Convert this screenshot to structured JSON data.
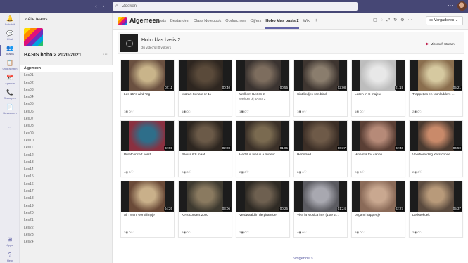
{
  "titlebar": {
    "search_placeholder": "Zoeken",
    "more": "···"
  },
  "rail": {
    "items": [
      {
        "label": "Activiteit",
        "icon": "bell-icon",
        "glyph": "🔔"
      },
      {
        "label": "Chat",
        "icon": "chat-icon",
        "glyph": "💬"
      },
      {
        "label": "Teams",
        "icon": "teams-icon",
        "glyph": "👥"
      },
      {
        "label": "Opdrachten",
        "icon": "assignments-icon",
        "glyph": "📋"
      },
      {
        "label": "Agenda",
        "icon": "calendar-icon",
        "glyph": "📅"
      },
      {
        "label": "Oproepen",
        "icon": "phone-icon",
        "glyph": "📞"
      },
      {
        "label": "Bestanden",
        "icon": "files-icon",
        "glyph": "📄"
      },
      {
        "label": "···",
        "icon": "more-icon",
        "glyph": ""
      },
      {
        "label": "Apps",
        "icon": "apps-icon",
        "glyph": "⊞"
      },
      {
        "label": "Help",
        "icon": "help-icon",
        "glyph": "?"
      }
    ]
  },
  "sidebar": {
    "back_label": "Alle teams",
    "team_name": "BASIS hobo 2 2020-2021",
    "team_more": "···",
    "channels": [
      "Algemeen",
      "Les01",
      "Les02",
      "Les03",
      "Les04",
      "Les05",
      "Les06",
      "Les07",
      "Les08",
      "Les09",
      "Les10",
      "Les11",
      "Les12",
      "Les13",
      "Les14",
      "Les15",
      "Les16",
      "Les17",
      "Les18",
      "Les19",
      "Les20",
      "Les21",
      "Les22",
      "Les23",
      "Les24"
    ]
  },
  "header": {
    "channel_title": "Algemeen",
    "tabs": [
      "Posts",
      "Bestanden",
      "Class Notebook",
      "Opdrachten",
      "Cijfers",
      "Hobo klas basis 2",
      "Wiki"
    ],
    "active_tab": "Hobo klas basis 2",
    "add_tab": "+",
    "meet_label": "Vergaderen"
  },
  "stream": {
    "title": "Hobo klas basis 2",
    "subtitle": "36 video's | 0 volgers",
    "brand": "Microsoft Stream"
  },
  "videos": [
    {
      "title": "Les 15 's wird Tag",
      "sub": "",
      "duration": "02:11",
      "views": "1",
      "likes": "0",
      "colors": [
        "#c9b48a",
        "#6a5040"
      ]
    },
    {
      "title": "Mozart Sonate nr 11",
      "sub": "",
      "duration": "00:40",
      "views": "1",
      "likes": "0",
      "colors": [
        "#5a4a3a",
        "#2e2620"
      ]
    },
    {
      "title": "Welkom BASIS 2",
      "sub": "Welkom bij BASIS 2",
      "duration": "00:56",
      "views": "1",
      "likes": "0",
      "colors": [
        "#7d6d5e",
        "#3a3330"
      ]
    },
    {
      "title": "Sint liedjes van blad",
      "sub": "",
      "duration": "02:08",
      "views": "1",
      "likes": "0",
      "colors": [
        "#8a7d6d",
        "#3e3530"
      ]
    },
    {
      "title": "Lezen in C majeur",
      "sub": "",
      "duration": "01:19",
      "views": "1",
      "likes": "0",
      "colors": [
        "#e8e8e8",
        "#bdbdbd"
      ]
    },
    {
      "title": "Trappetjes en toonladders ...",
      "sub": "",
      "duration": "05:21",
      "views": "2",
      "likes": "0",
      "colors": [
        "#d6c9a0",
        "#8a6e4e"
      ]
    },
    {
      "title": "Proefconcert kerst",
      "sub": "",
      "duration": "02:59",
      "views": "4",
      "likes": "0",
      "colors": [
        "#2e6e8a",
        "#8a3040"
      ]
    },
    {
      "title": "Bilou's 6:8 maat",
      "sub": "",
      "duration": "02:28",
      "views": "2",
      "likes": "0",
      "colors": [
        "#6b5a48",
        "#2d2620"
      ]
    },
    {
      "title": "Herfst is hier in a mineur",
      "sub": "",
      "duration": "01:05",
      "views": "2",
      "likes": "0",
      "colors": [
        "#7a6a50",
        "#3a3028"
      ]
    },
    {
      "title": "Herfstlied",
      "sub": "",
      "duration": "00:37",
      "views": "2",
      "likes": "0",
      "colors": [
        "#6e5a48",
        "#3b2e26"
      ]
    },
    {
      "title": "Hine ma tov canon",
      "sub": "",
      "duration": "02:48",
      "views": "2",
      "likes": "0",
      "colors": [
        "#b68a78",
        "#5a3f35"
      ]
    },
    {
      "title": "Voorbereiding Kerstconce...",
      "sub": "",
      "duration": "04:59",
      "views": "2",
      "likes": "0",
      "colors": [
        "#c98a6a",
        "#4a3a30"
      ]
    },
    {
      "title": "All I want werkfilmpje",
      "sub": "",
      "duration": "04:26",
      "views": "3",
      "likes": "0",
      "colors": [
        "#c9b08a",
        "#6a4a38"
      ]
    },
    {
      "title": "Kerstconcert 2020",
      "sub": "",
      "duration": "03:06",
      "views": "2",
      "likes": "0",
      "colors": [
        "#8a7a60",
        "#3e3a30"
      ]
    },
    {
      "title": "Verdwaald in de piramide",
      "sub": "",
      "duration": "00:26",
      "views": "2",
      "likes": "0",
      "colors": [
        "#6e6050",
        "#2e2a24"
      ]
    },
    {
      "title": "Viva la Musica in F (1ste 2 ...",
      "sub": "",
      "duration": "01:24",
      "views": "4",
      "likes": "0",
      "colors": [
        "#a8a8b0",
        "#5a5a60"
      ]
    },
    {
      "title": "origami happertje",
      "sub": "",
      "duration": "02:27",
      "views": "4",
      "likes": "0",
      "colors": [
        "#c9a890",
        "#8a6a58"
      ]
    },
    {
      "title": "De koekoek",
      "sub": "",
      "duration": "05:37",
      "views": "2",
      "likes": "0",
      "colors": [
        "#b89a7a",
        "#5a4a3e"
      ]
    }
  ],
  "pagination": {
    "next_label": "Volgende >"
  }
}
